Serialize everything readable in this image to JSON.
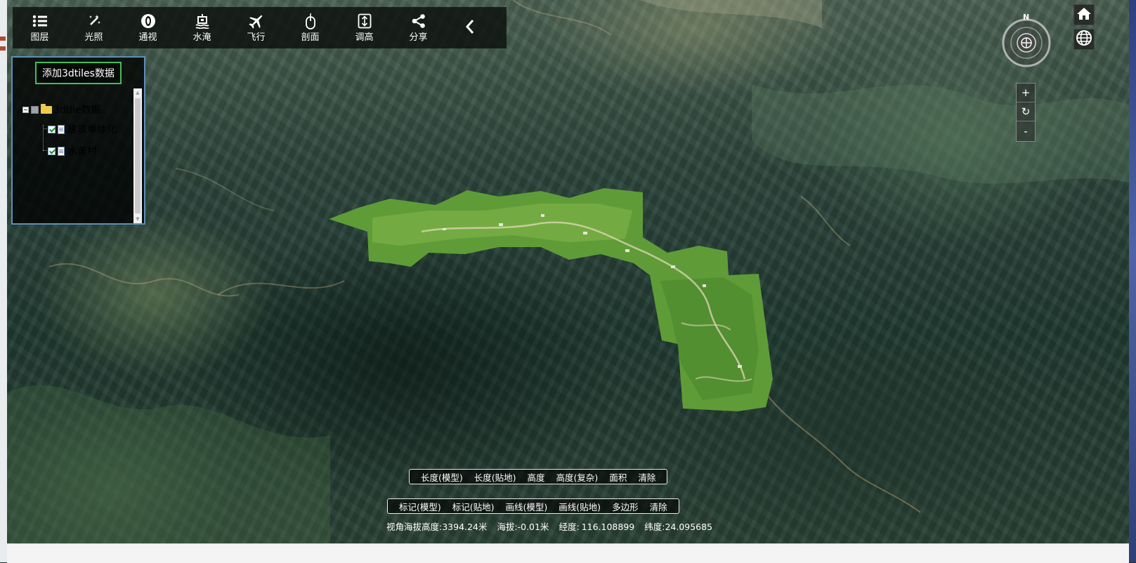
{
  "toolbar": {
    "items": [
      {
        "label": "图层",
        "icon": "list-icon"
      },
      {
        "label": "光照",
        "icon": "sparkle-wand-icon"
      },
      {
        "label": "通视",
        "icon": "eye-icon"
      },
      {
        "label": "水淹",
        "icon": "water-level-icon"
      },
      {
        "label": "飞行",
        "icon": "airplane-icon"
      },
      {
        "label": "剖面",
        "icon": "mouse-profile-icon"
      },
      {
        "label": "调高",
        "icon": "height-adjust-icon"
      },
      {
        "label": "分享",
        "icon": "share-icon"
      }
    ],
    "collapse_icon": "chevron-left-icon"
  },
  "layer_panel": {
    "add_button": "添加3dtiles数据",
    "root": {
      "label": "3dtile数据",
      "state": "partial"
    },
    "children": [
      {
        "label": "建筑单体化",
        "checked": true
      },
      {
        "label": "水美村",
        "checked": true
      }
    ]
  },
  "navigation": {
    "compass_label": "N",
    "home_icon": "home-icon",
    "globe_icon": "globe-icon",
    "zoom_in": "+",
    "reset": "↻",
    "zoom_out": "-"
  },
  "measure_bar": [
    "长度(模型)",
    "长度(贴地)",
    "高度",
    "高度(复杂)",
    "面积",
    "清除"
  ],
  "draw_bar": [
    "标记(模型)",
    "标记(贴地)",
    "画线(模型)",
    "画线(贴地)",
    "多边形",
    "清除"
  ],
  "status": {
    "view_height_label": "视角海拔高度:",
    "view_height_value": "3394.24米",
    "altitude_label": "海拔:",
    "altitude_value": "-0.01米",
    "longitude_label": "经度:",
    "longitude_value": "116.108899",
    "latitude_label": "纬度:",
    "latitude_value": "24.095685"
  },
  "colors": {
    "toolbar_bg": "#0c100e",
    "panel_border": "#5f8fb8",
    "add_button_border": "#3fbf5a",
    "overlay_green": "#5d9a36"
  }
}
